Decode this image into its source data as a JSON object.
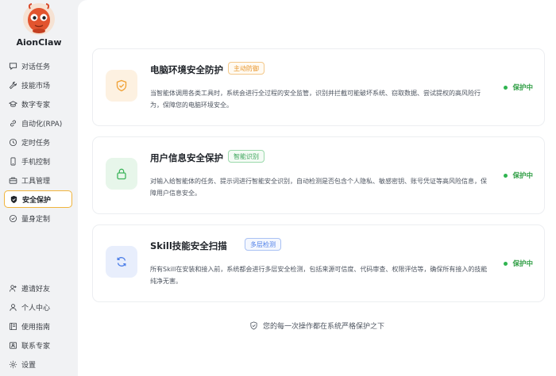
{
  "app": {
    "name": "AionClaw"
  },
  "sidebar": {
    "items": [
      {
        "label": "对话任务",
        "icon": "chat-icon"
      },
      {
        "label": "技能市场",
        "icon": "wrench-icon"
      },
      {
        "label": "数字专家",
        "icon": "graduation-cap-icon"
      },
      {
        "label": "自动化(RPA)",
        "icon": "link-icon"
      },
      {
        "label": "定时任务",
        "icon": "clock-icon"
      },
      {
        "label": "手机控制",
        "icon": "phone-icon"
      },
      {
        "label": "工具管理",
        "icon": "toolbox-icon"
      },
      {
        "label": "安全保护",
        "icon": "shield-check-icon",
        "active": true
      },
      {
        "label": "量身定制",
        "icon": "settings-check-icon"
      }
    ],
    "bottom_items": [
      {
        "label": "邀请好友",
        "icon": "invite-user-icon"
      },
      {
        "label": "个人中心",
        "icon": "user-icon"
      },
      {
        "label": "使用指南",
        "icon": "book-icon"
      },
      {
        "label": "联系专家",
        "icon": "contact-icon"
      },
      {
        "label": "设置",
        "icon": "gear-icon"
      }
    ]
  },
  "cards": [
    {
      "title": "电脑环境安全防护",
      "tag": "主动防御",
      "description": "当智能体调用各类工具时，系统会进行全过程的安全监管，识别并拦截可能破坏系统、窃取数据、尝试提权的高风险行为，保障您的电脑环境安全。",
      "status": "保护中",
      "icon": "shield-check-icon",
      "accent": "#f0a032"
    },
    {
      "title": "用户信息安全保护",
      "tag": "智能识别",
      "description": "对输入给智能体的任务、提示词进行智能安全识别，自动检测是否包含个人隐私、敏感密钥、账号凭证等高风险信息，保障用户信息安全。",
      "status": "保护中",
      "icon": "lock-icon",
      "accent": "#3cb45a"
    },
    {
      "title": "Skill技能安全扫描",
      "tag": "多层检测",
      "description": "所有Skill在安装和接入前，系统都会进行多层安全检测，包括来源可信度、代码审查、权限评估等，确保所有接入的技能纯净无害。",
      "status": "保护中",
      "icon": "refresh-icon",
      "accent": "#4c7ee8"
    }
  ],
  "footer": {
    "note": "您的每一次操作都在系统严格保护之下"
  }
}
